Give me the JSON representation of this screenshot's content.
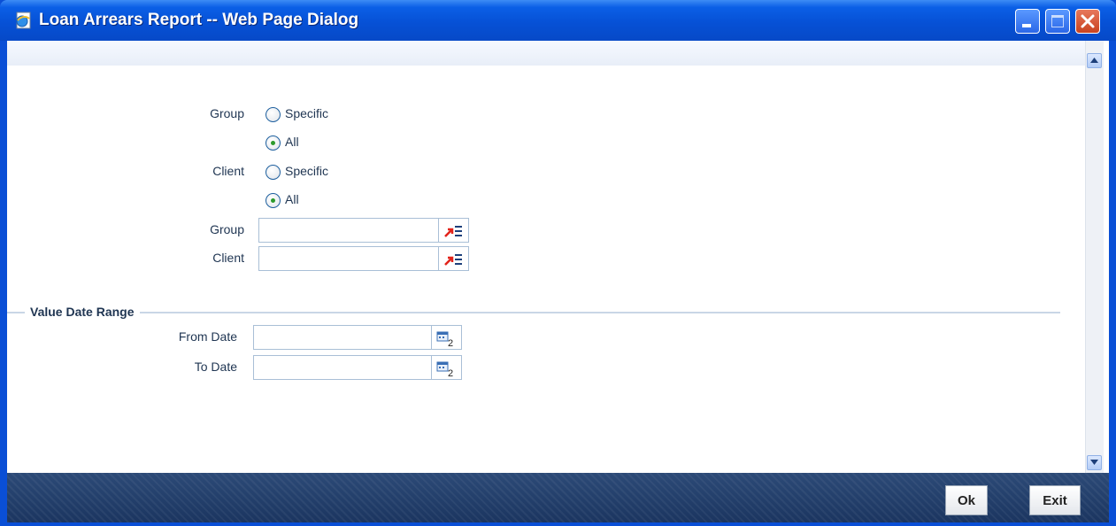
{
  "window": {
    "title": "Loan Arrears Report -- Web Page Dialog",
    "icon": "ie-page-icon"
  },
  "form": {
    "group_selector": {
      "label": "Group",
      "options": [
        {
          "label": "Specific",
          "selected": false
        },
        {
          "label": "All",
          "selected": true
        }
      ]
    },
    "client_selector": {
      "label": "Client",
      "options": [
        {
          "label": "Specific",
          "selected": false
        },
        {
          "label": "All",
          "selected": true
        }
      ]
    },
    "group_field": {
      "label": "Group",
      "value": ""
    },
    "client_field": {
      "label": "Client",
      "value": ""
    },
    "value_date_range": {
      "title": "Value Date Range",
      "from_date": {
        "label": "From Date",
        "value": ""
      },
      "to_date": {
        "label": "To Date",
        "value": ""
      }
    }
  },
  "footer": {
    "ok_label": "Ok",
    "exit_label": "Exit"
  },
  "colors": {
    "titlebar": "#0651d6",
    "footer": "#1b3560",
    "label_text": "#1f3552",
    "radio_checked": "#2c9a2c"
  }
}
